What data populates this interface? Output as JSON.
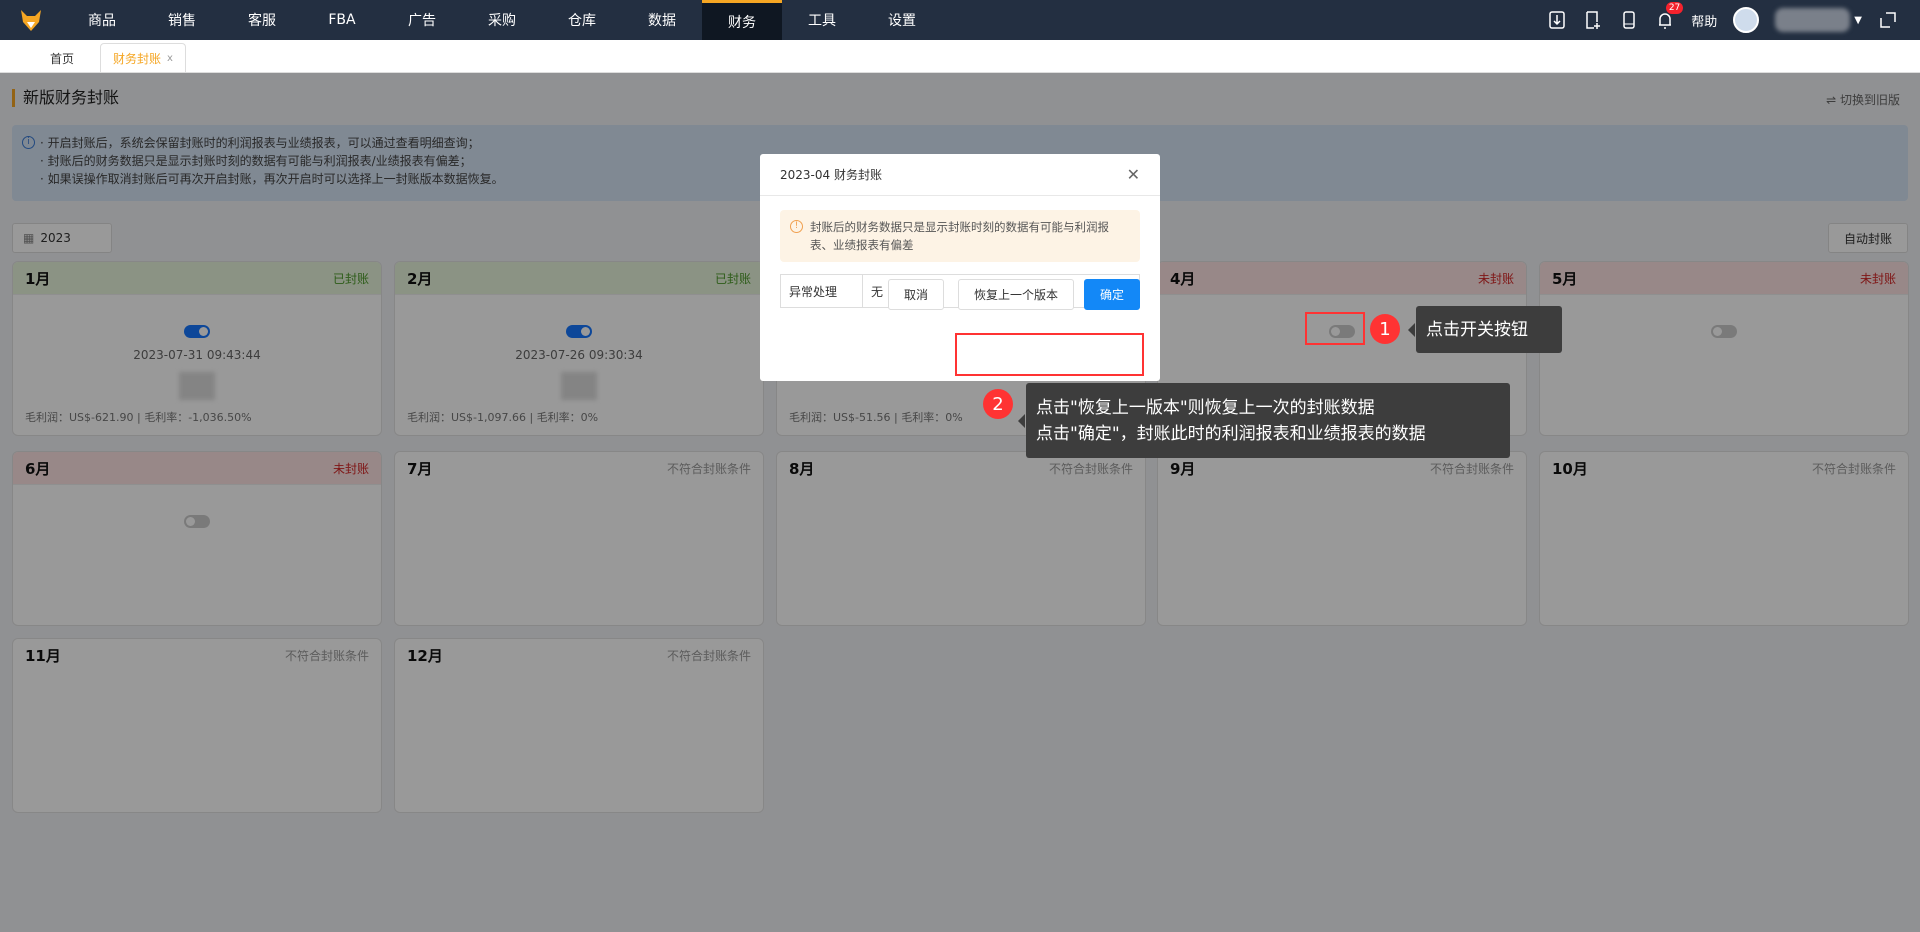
{
  "nav": {
    "items": [
      "商品",
      "销售",
      "客服",
      "FBA",
      "广告",
      "采购",
      "仓库",
      "数据",
      "财务",
      "工具",
      "设置"
    ],
    "active": "财务",
    "notification_count": "27",
    "help": "帮助"
  },
  "tabs": [
    {
      "label": "首页"
    },
    {
      "label": "财务封账",
      "close": "x"
    }
  ],
  "page": {
    "title": "新版财务封账",
    "switch_label": "⇌ 切换到旧版",
    "info": [
      "· 开启封账后，系统会保留封账时的利润报表与业绩报表，可以通过查看明细查询；",
      "· 封账后的财务数据只是显示封账时刻的数据有可能与利润报表/业绩报表有偏差；",
      "· 如果误操作取消封账后可再次开启封账，再次开启时可以选择上一封账版本数据恢复。"
    ],
    "year": "2023",
    "auto_button": "自动封账"
  },
  "months": [
    {
      "label": "1月",
      "status": "已封账",
      "state": "closed",
      "toggle_on": true,
      "time": "2023-07-31 09:43:44",
      "footer": "毛利润：US$-621.90  |  毛利率：-1,036.50%"
    },
    {
      "label": "2月",
      "status": "已封账",
      "state": "closed",
      "toggle_on": true,
      "time": "2023-07-26 09:30:34",
      "footer": "毛利润：US$-1,097.66  |  毛利率：0%"
    },
    {
      "label": "",
      "status": "",
      "state": "hidden",
      "toggle_on": null,
      "time": "",
      "footer": "毛利润：US$-51.56  |  毛利率：0%"
    },
    {
      "label": "4月",
      "status": "未封账",
      "state": "open",
      "toggle_on": false
    },
    {
      "label": "5月",
      "status": "未封账",
      "state": "open",
      "toggle_on": false
    },
    {
      "label": "6月",
      "status": "未封账",
      "state": "open",
      "toggle_on": false
    },
    {
      "label": "7月",
      "status": "不符合封账条件",
      "state": "na"
    },
    {
      "label": "8月",
      "status": "不符合封账条件",
      "state": "na"
    },
    {
      "label": "9月",
      "status": "不符合封账条件",
      "state": "na"
    },
    {
      "label": "10月",
      "status": "不符合封账条件",
      "state": "na"
    },
    {
      "label": "11月",
      "status": "不符合封账条件",
      "state": "na"
    },
    {
      "label": "12月",
      "status": "不符合封账条件",
      "state": "na"
    }
  ],
  "modal": {
    "title": "2023-04 财务封账",
    "warning": "封账后的财务数据只是显示封账时刻的数据有可能与利润报表、业绩报表有偏差",
    "field_label": "异常处理",
    "field_value": "无",
    "cancel": "取消",
    "restore": "恢复上一个版本",
    "confirm": "确定"
  },
  "annotations": {
    "one": "1",
    "one_text": "点击开关按钮",
    "two": "2",
    "two_lines": [
      "点击\"恢复上一版本\"则恢复上一次的封账数据",
      "点击\"确定\"，封账此时的利润报表和业绩报表的数据"
    ]
  },
  "colors": {
    "nav_bg": "#232f41",
    "accent": "#f5a623",
    "primary": "#1388f7",
    "closed": "#4c9a2a",
    "open": "#d42626",
    "annotation": "#ff3333"
  }
}
